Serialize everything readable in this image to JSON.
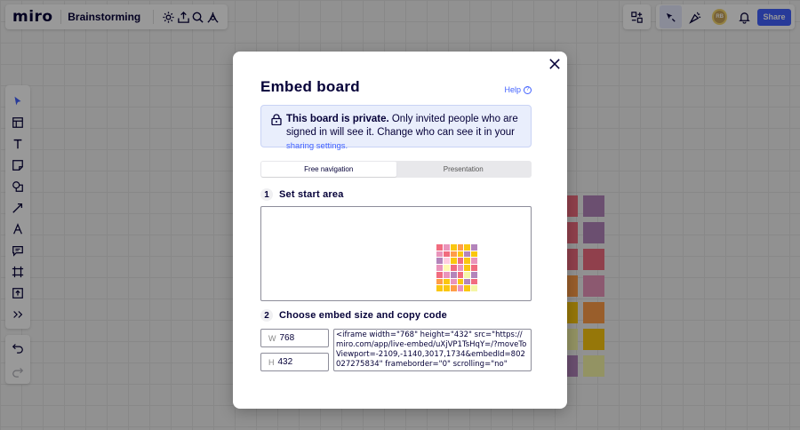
{
  "app": {
    "logo": "miro",
    "board_name": "Brainstorming"
  },
  "topbar": {
    "icons": [
      "settings-icon",
      "export-icon",
      "search-icon",
      "integrations-icon"
    ],
    "right_icons": [
      "apps-icon",
      "cursor-icon",
      "reactions-icon",
      "notifications-icon"
    ],
    "avatar_initials": "RB",
    "share_label": "Share"
  },
  "toolbar": {
    "tools": [
      "select-icon",
      "templates-icon",
      "text-icon",
      "sticky-note-icon",
      "shapes-icon",
      "connection-line-icon",
      "pen-icon",
      "comment-icon",
      "frame-icon",
      "upload-icon",
      "more-tools-icon"
    ],
    "undo": "undo-icon",
    "redo": "redo-icon"
  },
  "modal": {
    "title": "Embed board",
    "help_label": "Help",
    "private_bold": "This board is private.",
    "private_text": " Only invited people who are signed in will see it. Change who can see it in your ",
    "private_link": "sharing settings.",
    "tabs": [
      {
        "label": "Free navigation",
        "active": true
      },
      {
        "label": "Presentation",
        "active": false
      }
    ],
    "step1": {
      "num": "1",
      "label": "Set start area"
    },
    "step2": {
      "num": "2",
      "label": "Choose embed size and copy code"
    },
    "width_label": "W",
    "width_value": "768",
    "height_label": "H",
    "height_value": "432",
    "embed_code": "<iframe width=\"768\" height=\"432\" src=\"https://miro.com/app/live-embed/uXjVP1TsHqY=/?moveToViewport=-2109,-1140,3017,1734&embedId=802027275834\" frameborder=\"0\" scrolling=\"no\""
  },
  "colors": {
    "accent": "#4262ff",
    "sticky_colors": [
      "#f16c7f",
      "#ea94bb",
      "#ff9d48",
      "#fac710",
      "#f5f6a6",
      "#b384bb",
      "#fff9b1",
      "#ffcee0"
    ]
  }
}
